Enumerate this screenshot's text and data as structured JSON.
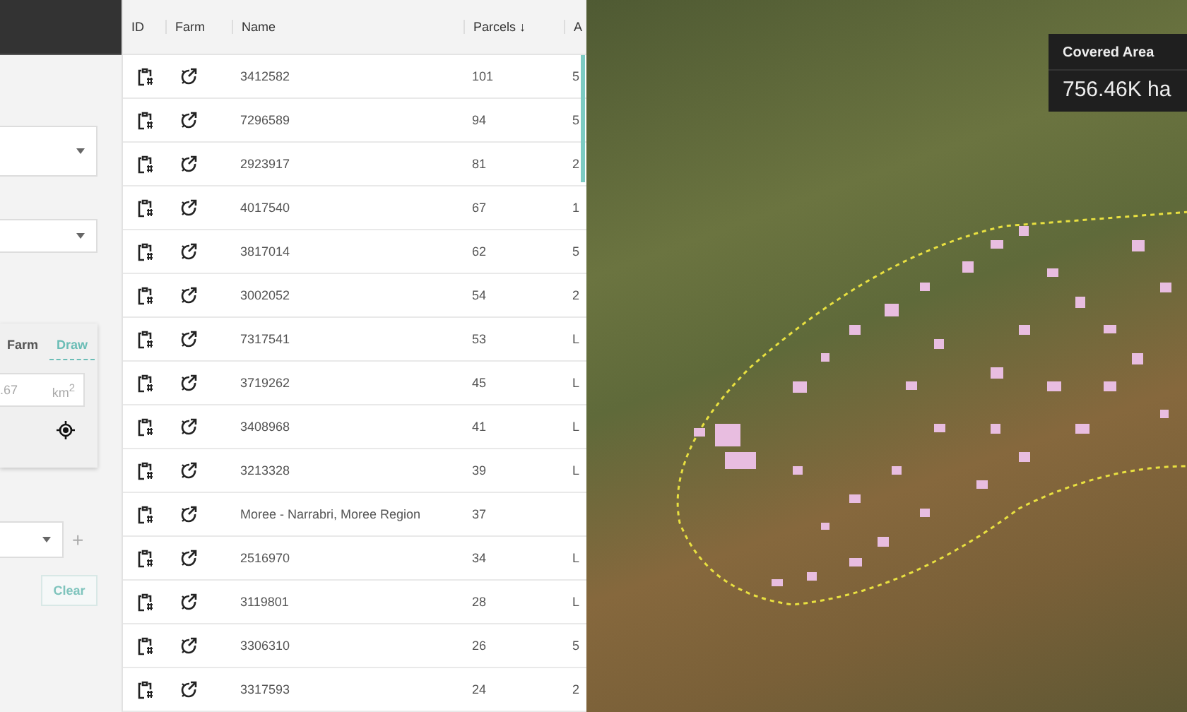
{
  "sidebar": {
    "tabs": [
      {
        "label": "Farm",
        "selected": false
      },
      {
        "label": "Draw",
        "selected": true
      }
    ],
    "area_field": {
      "value": ".67",
      "unit": "km$^{2}$"
    },
    "add_button": "+",
    "clear_button": "Clear"
  },
  "table": {
    "columns": [
      "ID",
      "Farm",
      "Name",
      "Parcels",
      "A"
    ],
    "sort_indicator": "↓",
    "rows": [
      {
        "name": "3412582",
        "parcels": "101",
        "column_5": "5"
      },
      {
        "name": "7296589",
        "parcels": "94",
        "column_5": "5"
      },
      {
        "name": "2923917",
        "parcels": "81",
        "column_5": "2"
      },
      {
        "name": "4017540",
        "parcels": "67",
        "column_5": "1"
      },
      {
        "name": "3817014",
        "parcels": "62",
        "column_5": "5"
      },
      {
        "name": "3002052",
        "parcels": "54",
        "column_5": "2"
      },
      {
        "name": "7317541",
        "parcels": "53",
        "column_5": "L"
      },
      {
        "name": "3719262",
        "parcels": "45",
        "column_5": "L"
      },
      {
        "name": "3408968",
        "parcels": "41",
        "column_5": "L"
      },
      {
        "name": "3213328",
        "parcels": "39",
        "column_5": "L"
      },
      {
        "name": "Moree - Narrabri, Moree Region",
        "parcels": "37"
      },
      {
        "name": "2516970",
        "parcels": "34",
        "column_5": "L"
      },
      {
        "name": "3119801",
        "parcels": "28",
        "column_5": "L"
      },
      {
        "name": "3306310",
        "parcels": "26",
        "column_5": "5"
      },
      {
        "name": "3317593",
        "parcels": "24",
        "column_5": "2"
      }
    ]
  },
  "map": {
    "covered_area": {
      "label": "Covered Area",
      "value": "756.46K ha"
    }
  }
}
